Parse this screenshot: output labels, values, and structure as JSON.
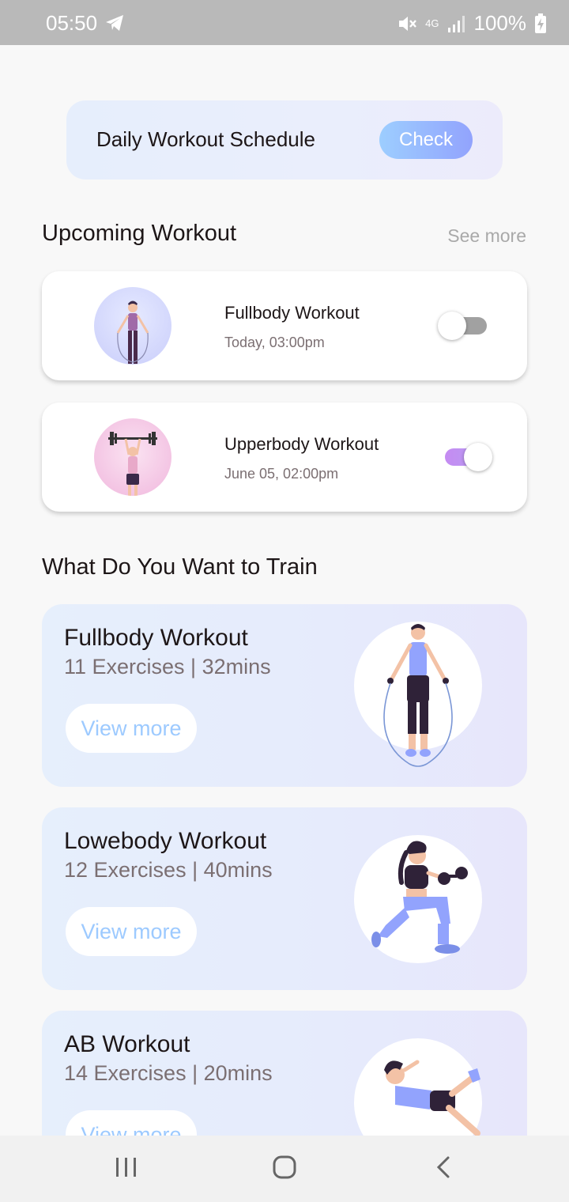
{
  "status_bar": {
    "time": "05:50",
    "network": "4G",
    "battery": "100%",
    "icons": [
      "telegram-icon",
      "mute-icon",
      "signal-icon",
      "battery-charging-icon"
    ]
  },
  "schedule": {
    "title": "Daily Workout Schedule",
    "button_label": "Check"
  },
  "upcoming": {
    "heading": "Upcoming Workout",
    "see_more": "See more",
    "items": [
      {
        "title": "Fullbody Workout",
        "time": "Today, 03:00pm",
        "enabled": false
      },
      {
        "title": "Upperbody Workout",
        "time": "June 05, 02:00pm",
        "enabled": true
      }
    ]
  },
  "train": {
    "heading": "What Do You Want to Train",
    "items": [
      {
        "title": "Fullbody Workout",
        "meta": "11 Exercises | 32mins",
        "button": "View more",
        "illustration": "jump-rope-illustration"
      },
      {
        "title": "Lowebody Workout",
        "meta": "12 Exercises | 40mins",
        "button": "View more",
        "illustration": "lunge-dumbbell-illustration"
      },
      {
        "title": "AB Workout",
        "meta": "14 Exercises | 20mins",
        "button": "View more",
        "illustration": "situp-illustration"
      }
    ]
  },
  "colors": {
    "brand_blue": "#92A3FD",
    "brand_light_blue": "#9DCEFF",
    "toggle_on": "#C58BF2",
    "toggle_off": "#A1A1A1",
    "text_dark": "#1D1617",
    "text_gray": "#7B6F72"
  },
  "nav_bar": {
    "icons": [
      "recent-apps-icon",
      "home-icon",
      "back-icon"
    ]
  }
}
